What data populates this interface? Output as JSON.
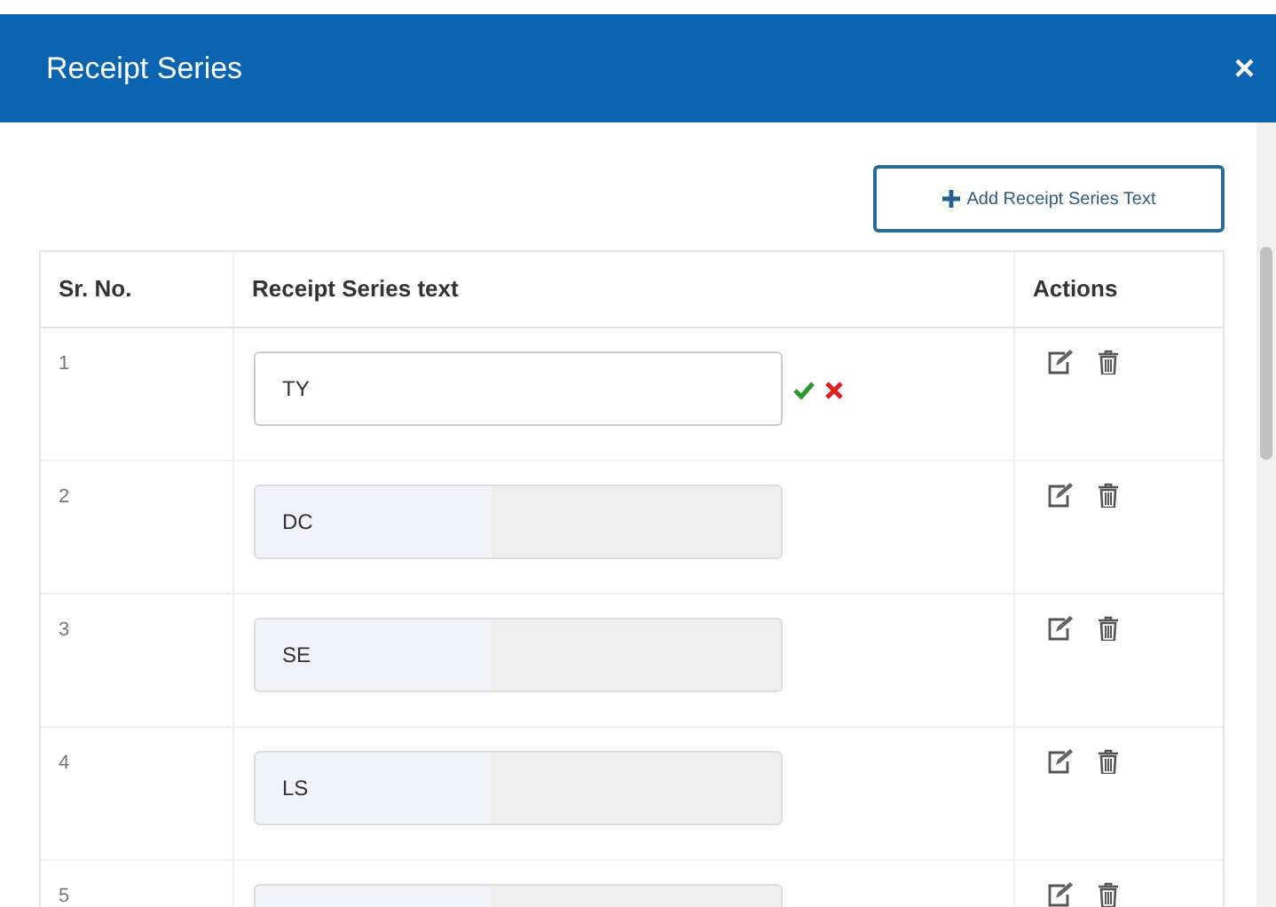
{
  "dialog": {
    "title": "Receipt Series",
    "close": "×"
  },
  "add_button": {
    "label": "Add Receipt Series Text"
  },
  "table": {
    "columns": [
      "Sr. No.",
      "Receipt Series text",
      "Actions"
    ],
    "rows": [
      {
        "sr_no": "1",
        "value": "TY",
        "editing": true
      },
      {
        "sr_no": "2",
        "value": "DC",
        "editing": false
      },
      {
        "sr_no": "3",
        "value": "SE",
        "editing": false
      },
      {
        "sr_no": "4",
        "value": "LS",
        "editing": false
      },
      {
        "sr_no": "5",
        "editing": false
      }
    ]
  }
}
